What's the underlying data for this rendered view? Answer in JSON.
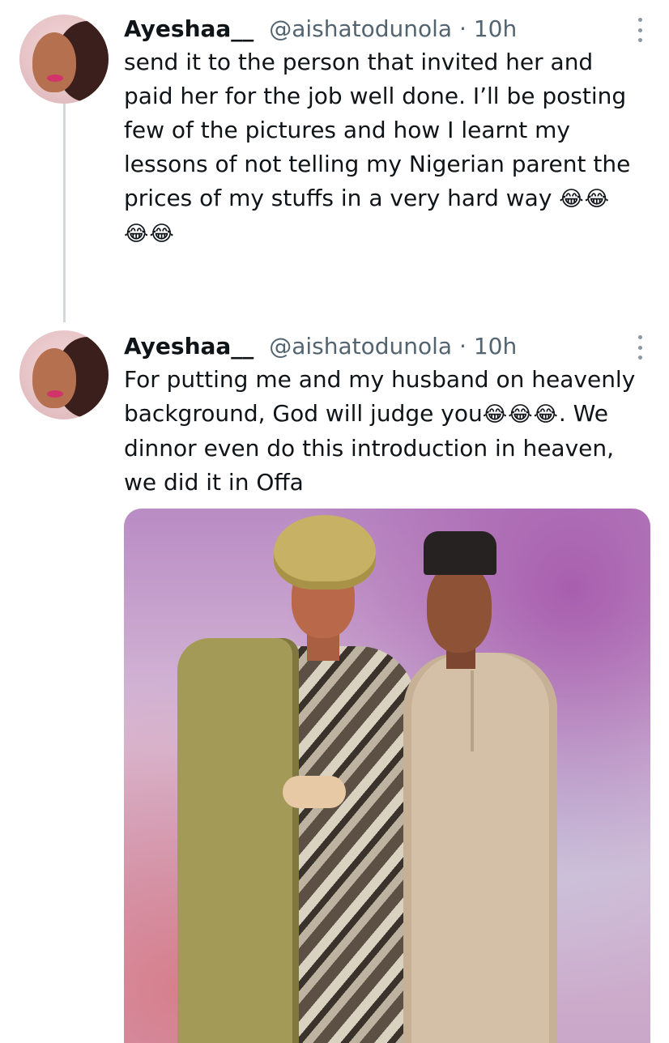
{
  "thread": [
    {
      "author": {
        "name": "Ayeshaa__",
        "handle": "@aishatodunola",
        "separator": "·",
        "time": "10h"
      },
      "lines": [
        "send it to the person that invited her and",
        "paid her for the job well done. I’ll be posting",
        "few of the pictures and how I learnt my",
        "lessons of not telling my Nigerian parent the",
        "prices of my stuffs in a very hard way"
      ],
      "line5_emoji": "😂😂",
      "line6_emoji": "😂😂"
    },
    {
      "author": {
        "name": "Ayeshaa__",
        "handle": "@aishatodunola",
        "separator": "·",
        "time": "10h"
      },
      "line1": "For putting me and my husband on heavenly",
      "line2_before": "background, God will judge you",
      "line2_emoji": "😂😂😂",
      "line2_after": ". We",
      "line3": "dinnor even do this introduction in heaven,",
      "line4": "we did it in Offa"
    }
  ]
}
